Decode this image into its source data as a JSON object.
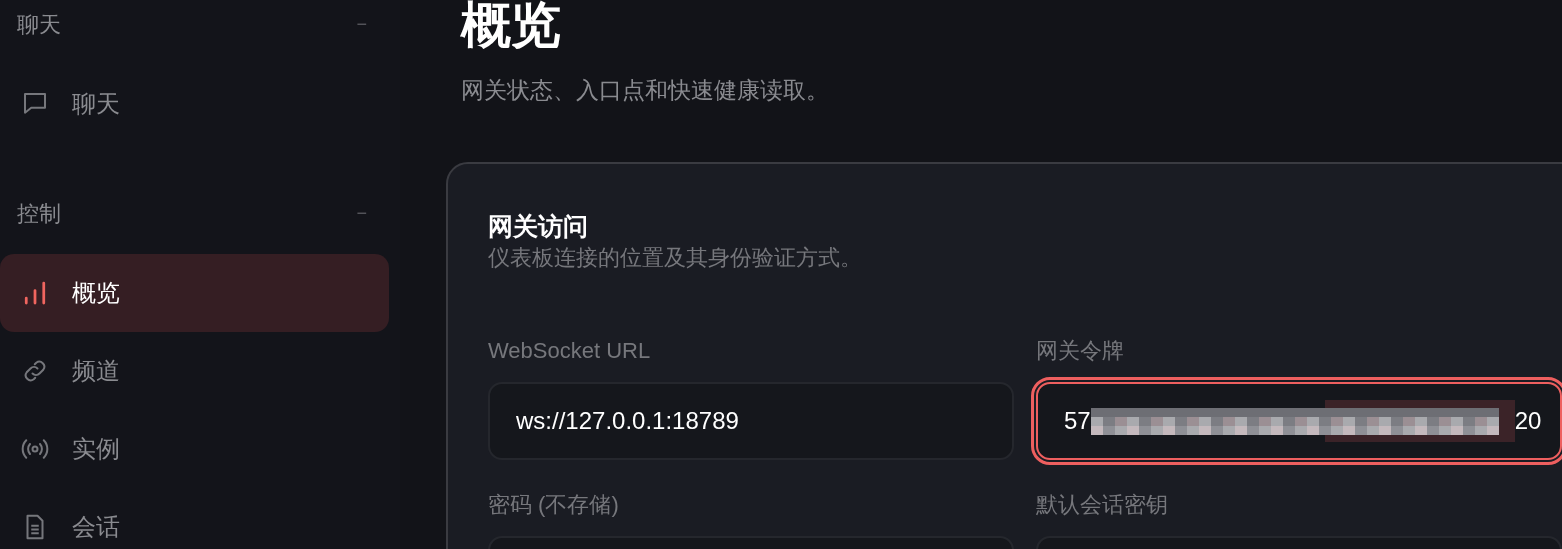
{
  "sidebar": {
    "groups": [
      {
        "label": "聊天",
        "collapse_glyph": "−",
        "items": [
          {
            "label": "聊天",
            "kind": "chat",
            "selected": false
          }
        ]
      },
      {
        "label": "控制",
        "collapse_glyph": "−",
        "items": [
          {
            "label": "概览",
            "kind": "bars",
            "selected": true
          },
          {
            "label": "频道",
            "kind": "link",
            "selected": false
          },
          {
            "label": "实例",
            "kind": "broadcast",
            "selected": false
          },
          {
            "label": "会话",
            "kind": "document",
            "selected": false
          }
        ]
      }
    ]
  },
  "page": {
    "title": "概览",
    "subtitle": "网关状态、入口点和快速健康读取。"
  },
  "card": {
    "title": "网关访问",
    "description": "仪表板连接的位置及其身份验证方式。",
    "fields": [
      {
        "label": "WebSocket URL",
        "value": "ws://127.0.0.1:18789",
        "focused": false
      },
      {
        "label": "网关令牌",
        "value_start": "57",
        "value_end": "20",
        "redacted": true,
        "focused": true
      },
      {
        "label": "密码 (不存储)",
        "focused": false
      },
      {
        "label": "默认会话密钥",
        "focused": false
      }
    ]
  }
}
